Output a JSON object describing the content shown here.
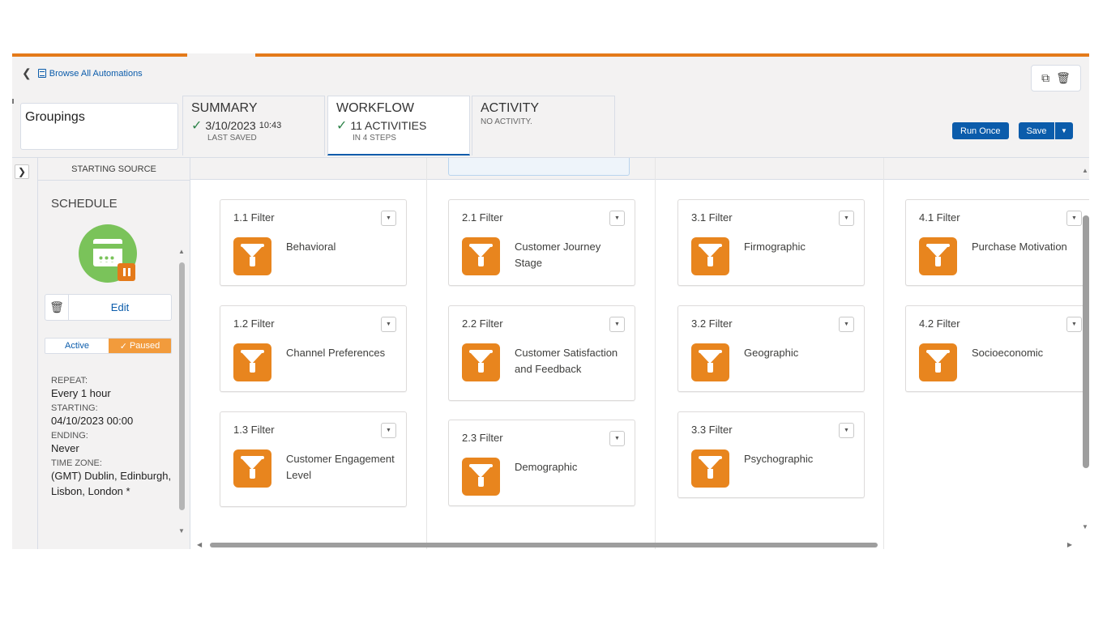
{
  "header": {
    "breadcrumb": "Browse All Automations",
    "automation_name": "Groupings"
  },
  "tabs": {
    "summary": {
      "title": "SUMMARY",
      "date": "3/10/2023",
      "time": "10:43",
      "sub": "LAST SAVED"
    },
    "workflow": {
      "title": "WORKFLOW",
      "main": "11 ACTIVITIES",
      "sub": "IN 4 STEPS"
    },
    "activity": {
      "title": "ACTIVITY",
      "sub": "NO ACTIVITY."
    }
  },
  "actions": {
    "run_once": "Run Once",
    "save": "Save"
  },
  "left_panel": {
    "header": "STARTING SOURCE",
    "schedule_title": "SCHEDULE",
    "edit": "Edit",
    "toggle_active": "Active",
    "toggle_paused": "Paused",
    "repeat_label": "REPEAT:",
    "repeat_value": "Every 1 hour",
    "starting_label": "STARTING:",
    "starting_value": "04/10/2023 00:00",
    "ending_label": "ENDING:",
    "ending_value": "Never",
    "timezone_label": "TIME ZONE:",
    "timezone_value": "(GMT) Dublin, Edinburgh, Lisbon, London *"
  },
  "workflow": {
    "step1": [
      {
        "title": "1.1 Filter",
        "label": "Behavioral"
      },
      {
        "title": "1.2 Filter",
        "label": "Channel Preferences"
      },
      {
        "title": "1.3 Filter",
        "label": "Customer Engagement Level"
      }
    ],
    "step2": [
      {
        "title": "2.1 Filter",
        "label": "Customer Journey Stage"
      },
      {
        "title": "2.2 Filter",
        "label": "Customer Satisfaction and Feedback"
      },
      {
        "title": "2.3 Filter",
        "label": "Demographic"
      }
    ],
    "step3": [
      {
        "title": "3.1 Filter",
        "label": "Firmographic"
      },
      {
        "title": "3.2 Filter",
        "label": "Geographic"
      },
      {
        "title": "3.3 Filter",
        "label": "Psychographic"
      }
    ],
    "step4": [
      {
        "title": "4.1 Filter",
        "label": "Purchase Motivation"
      },
      {
        "title": "4.2 Filter",
        "label": "Socioeconomic"
      }
    ]
  },
  "colors": {
    "accent_orange": "#e47a1a",
    "primary_blue": "#0b5cab",
    "schedule_green": "#7ac35a",
    "filter_icon_orange": "#e8851e",
    "check_green": "#2e844a"
  },
  "icons": {
    "back": "chevron-left-icon",
    "breadcrumb": "list-icon",
    "copy": "copy-icon",
    "delete": "trash-icon",
    "schedule": "calendar-icon",
    "paused": "pause-icon",
    "filter": "funnel-icon",
    "card_menu": "chevron-down-icon",
    "expand": "chevron-right-icon"
  }
}
